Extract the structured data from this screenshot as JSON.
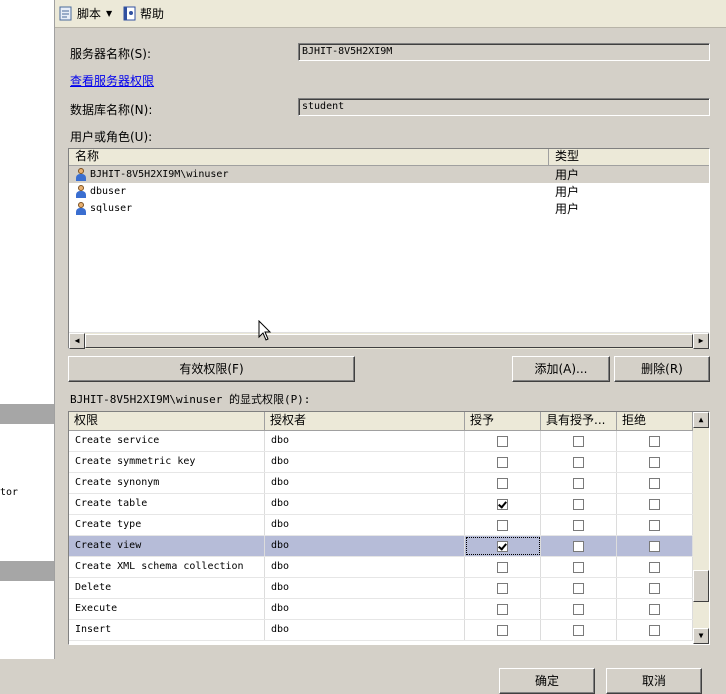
{
  "toolbar": {
    "script_label": "脚本",
    "help_label": "帮助"
  },
  "server": {
    "label": "服务器名称(S):",
    "value": "BJHIT-8V5H2XI9M",
    "view_permissions_link": "查看服务器权限"
  },
  "database": {
    "label": "数据库名称(N):",
    "value": "student"
  },
  "users": {
    "label": "用户或角色(U):",
    "columns": [
      "名称",
      "类型"
    ],
    "rows": [
      {
        "name": "BJHIT-8V5H2XI9M\\winuser",
        "type": "用户",
        "selected": true
      },
      {
        "name": "dbuser",
        "type": "用户"
      },
      {
        "name": "sqluser",
        "type": "用户"
      }
    ]
  },
  "buttons": {
    "effective": "有效权限(F)",
    "add": "添加(A)...",
    "remove": "删除(R)",
    "ok": "确定",
    "cancel": "取消"
  },
  "permissions": {
    "label": "BJHIT-8V5H2XI9M\\winuser 的显式权限(P):",
    "columns": [
      "权限",
      "授权者",
      "授予",
      "具有授予...",
      "拒绝"
    ],
    "rows": [
      {
        "name": "Create service",
        "grantor": "dbo",
        "grant": false,
        "with_grant": false,
        "deny": false
      },
      {
        "name": "Create symmetric key",
        "grantor": "dbo",
        "grant": false,
        "with_grant": false,
        "deny": false
      },
      {
        "name": "Create synonym",
        "grantor": "dbo",
        "grant": false,
        "with_grant": false,
        "deny": false
      },
      {
        "name": "Create table",
        "grantor": "dbo",
        "grant": true,
        "with_grant": false,
        "deny": false
      },
      {
        "name": "Create type",
        "grantor": "dbo",
        "grant": false,
        "with_grant": false,
        "deny": false
      },
      {
        "name": "Create view",
        "grantor": "dbo",
        "grant": true,
        "with_grant": false,
        "deny": false,
        "selected": true
      },
      {
        "name": "Create XML schema collection",
        "grantor": "dbo",
        "grant": false,
        "with_grant": false,
        "deny": false
      },
      {
        "name": "Delete",
        "grantor": "dbo",
        "grant": false,
        "with_grant": false,
        "deny": false
      },
      {
        "name": "Execute",
        "grantor": "dbo",
        "grant": false,
        "with_grant": false,
        "deny": false
      },
      {
        "name": "Insert",
        "grantor": "dbo",
        "grant": false,
        "with_grant": false,
        "deny": false
      }
    ]
  },
  "left_pane": {
    "partial_text": "tor"
  }
}
